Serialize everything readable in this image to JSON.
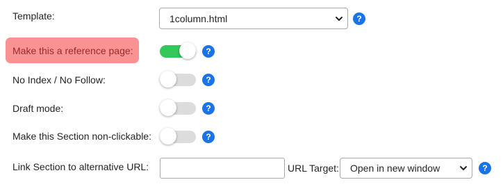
{
  "template": {
    "label": "Template:",
    "selected": "1column.html",
    "help": "?"
  },
  "reference_page": {
    "label": "Make this a reference page:",
    "enabled": true,
    "help": "?",
    "highlight_color": "#f99393"
  },
  "no_index": {
    "label": "No Index / No Follow:",
    "enabled": false,
    "help": "?"
  },
  "draft_mode": {
    "label": "Draft mode:",
    "enabled": false,
    "help": "?"
  },
  "non_clickable": {
    "label": "Make this Section non-clickable:",
    "enabled": false,
    "help": "?"
  },
  "alt_url": {
    "label": "Link Section to alternative URL:",
    "value": "",
    "url_target_label": "URL Target:",
    "url_target_selected": "Open in new window",
    "help": "?"
  },
  "colors": {
    "toggle_on": "#34c759",
    "toggle_off": "#dcdcdc",
    "help_icon": "#1a73e8"
  }
}
